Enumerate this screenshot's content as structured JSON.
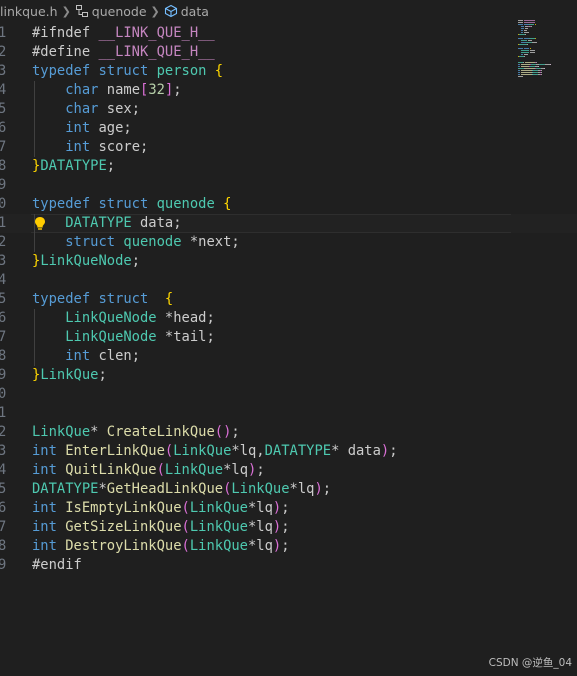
{
  "breadcrumb": {
    "file": "linkque.h",
    "symbol1": "quenode",
    "symbol2": "data",
    "icons": [
      "struct-icon",
      "field-icon"
    ]
  },
  "colors": {
    "background": "#1f1f1f",
    "keyword": "#569cd6",
    "type": "#4ec9b0",
    "function": "#dcdcaa",
    "variable": "#9cdcfe",
    "macro": "#c586c0",
    "number": "#b5cea8",
    "brace": "#ffd700",
    "paren": "#da70d6",
    "default": "#cccccc",
    "lineNumber": "#6e7681"
  },
  "editor": {
    "current_line": 10,
    "lines": [
      {
        "n": "1",
        "tokens": [
          {
            "t": "#ifndef ",
            "c": "default"
          },
          {
            "t": "__LINK_QUE_H__",
            "c": "macro"
          }
        ]
      },
      {
        "n": "2",
        "tokens": [
          {
            "t": "#define ",
            "c": "default"
          },
          {
            "t": "__LINK_QUE_H__",
            "c": "macro"
          }
        ]
      },
      {
        "n": "3",
        "tokens": [
          {
            "t": "typedef ",
            "c": "keyword"
          },
          {
            "t": "struct ",
            "c": "keyword"
          },
          {
            "t": "person ",
            "c": "type"
          },
          {
            "t": "{",
            "c": "brace"
          }
        ]
      },
      {
        "n": "4",
        "tokens": [
          {
            "t": "    ",
            "c": "default"
          },
          {
            "t": "char ",
            "c": "keyword"
          },
          {
            "t": "name",
            "c": "default"
          },
          {
            "t": "[",
            "c": "paren"
          },
          {
            "t": "32",
            "c": "number"
          },
          {
            "t": "]",
            "c": "paren"
          },
          {
            "t": ";",
            "c": "default"
          }
        ]
      },
      {
        "n": "5",
        "tokens": [
          {
            "t": "    ",
            "c": "default"
          },
          {
            "t": "char ",
            "c": "keyword"
          },
          {
            "t": "sex;",
            "c": "default"
          }
        ]
      },
      {
        "n": "6",
        "tokens": [
          {
            "t": "    ",
            "c": "default"
          },
          {
            "t": "int ",
            "c": "keyword"
          },
          {
            "t": "age;",
            "c": "default"
          }
        ]
      },
      {
        "n": "7",
        "tokens": [
          {
            "t": "    ",
            "c": "default"
          },
          {
            "t": "int ",
            "c": "keyword"
          },
          {
            "t": "score;",
            "c": "default"
          }
        ]
      },
      {
        "n": "8",
        "tokens": [
          {
            "t": "}",
            "c": "brace"
          },
          {
            "t": "DATATYPE",
            "c": "type"
          },
          {
            "t": ";",
            "c": "default"
          }
        ]
      },
      {
        "n": "9",
        "tokens": []
      },
      {
        "n": "0",
        "tokens": [
          {
            "t": "typedef ",
            "c": "keyword"
          },
          {
            "t": "struct ",
            "c": "keyword"
          },
          {
            "t": "quenode ",
            "c": "type"
          },
          {
            "t": "{",
            "c": "brace"
          }
        ]
      },
      {
        "n": "1",
        "tokens": [
          {
            "t": "    ",
            "c": "default"
          },
          {
            "t": "DATATYPE ",
            "c": "type"
          },
          {
            "t": "data;",
            "c": "default"
          }
        ]
      },
      {
        "n": "2",
        "tokens": [
          {
            "t": "    ",
            "c": "default"
          },
          {
            "t": "struct ",
            "c": "keyword"
          },
          {
            "t": "quenode ",
            "c": "type"
          },
          {
            "t": "*next;",
            "c": "default"
          }
        ]
      },
      {
        "n": "3",
        "tokens": [
          {
            "t": "}",
            "c": "brace"
          },
          {
            "t": "LinkQueNode",
            "c": "type"
          },
          {
            "t": ";",
            "c": "default"
          }
        ]
      },
      {
        "n": "4",
        "tokens": []
      },
      {
        "n": "5",
        "tokens": [
          {
            "t": "typedef ",
            "c": "keyword"
          },
          {
            "t": "struct  ",
            "c": "keyword"
          },
          {
            "t": "{",
            "c": "brace"
          }
        ]
      },
      {
        "n": "6",
        "tokens": [
          {
            "t": "    ",
            "c": "default"
          },
          {
            "t": "LinkQueNode ",
            "c": "type"
          },
          {
            "t": "*head;",
            "c": "default"
          }
        ]
      },
      {
        "n": "7",
        "tokens": [
          {
            "t": "    ",
            "c": "default"
          },
          {
            "t": "LinkQueNode ",
            "c": "type"
          },
          {
            "t": "*tail;",
            "c": "default"
          }
        ]
      },
      {
        "n": "8",
        "tokens": [
          {
            "t": "    ",
            "c": "default"
          },
          {
            "t": "int ",
            "c": "keyword"
          },
          {
            "t": "clen;",
            "c": "default"
          }
        ]
      },
      {
        "n": "9",
        "tokens": [
          {
            "t": "}",
            "c": "brace"
          },
          {
            "t": "LinkQue",
            "c": "type"
          },
          {
            "t": ";",
            "c": "default"
          }
        ]
      },
      {
        "n": "0",
        "tokens": []
      },
      {
        "n": "1",
        "tokens": []
      },
      {
        "n": "2",
        "tokens": [
          {
            "t": "LinkQue",
            "c": "type"
          },
          {
            "t": "* ",
            "c": "default"
          },
          {
            "t": "CreateLinkQue",
            "c": "function"
          },
          {
            "t": "()",
            "c": "paren"
          },
          {
            "t": ";",
            "c": "default"
          }
        ]
      },
      {
        "n": "3",
        "tokens": [
          {
            "t": "int ",
            "c": "keyword"
          },
          {
            "t": "EnterLinkQue",
            "c": "function"
          },
          {
            "t": "(",
            "c": "paren"
          },
          {
            "t": "LinkQue",
            "c": "type"
          },
          {
            "t": "*lq,",
            "c": "default"
          },
          {
            "t": "DATATYPE",
            "c": "type"
          },
          {
            "t": "* data",
            "c": "default"
          },
          {
            "t": ")",
            "c": "paren"
          },
          {
            "t": ";",
            "c": "default"
          }
        ]
      },
      {
        "n": "4",
        "tokens": [
          {
            "t": "int ",
            "c": "keyword"
          },
          {
            "t": "QuitLinkQue",
            "c": "function"
          },
          {
            "t": "(",
            "c": "paren"
          },
          {
            "t": "LinkQue",
            "c": "type"
          },
          {
            "t": "*lq",
            "c": "default"
          },
          {
            "t": ")",
            "c": "paren"
          },
          {
            "t": ";",
            "c": "default"
          }
        ]
      },
      {
        "n": "5",
        "tokens": [
          {
            "t": "DATATYPE",
            "c": "type"
          },
          {
            "t": "*",
            "c": "default"
          },
          {
            "t": "GetHeadLinkQue",
            "c": "function"
          },
          {
            "t": "(",
            "c": "paren"
          },
          {
            "t": "LinkQue",
            "c": "type"
          },
          {
            "t": "*lq",
            "c": "default"
          },
          {
            "t": ")",
            "c": "paren"
          },
          {
            "t": ";",
            "c": "default"
          }
        ]
      },
      {
        "n": "6",
        "tokens": [
          {
            "t": "int ",
            "c": "keyword"
          },
          {
            "t": "IsEmptyLinkQue",
            "c": "function"
          },
          {
            "t": "(",
            "c": "paren"
          },
          {
            "t": "LinkQue",
            "c": "type"
          },
          {
            "t": "*lq",
            "c": "default"
          },
          {
            "t": ")",
            "c": "paren"
          },
          {
            "t": ";",
            "c": "default"
          }
        ]
      },
      {
        "n": "7",
        "tokens": [
          {
            "t": "int ",
            "c": "keyword"
          },
          {
            "t": "GetSizeLinkQue",
            "c": "function"
          },
          {
            "t": "(",
            "c": "paren"
          },
          {
            "t": "LinkQue",
            "c": "type"
          },
          {
            "t": "*lq",
            "c": "default"
          },
          {
            "t": ")",
            "c": "paren"
          },
          {
            "t": ";",
            "c": "default"
          }
        ]
      },
      {
        "n": "8",
        "tokens": [
          {
            "t": "int ",
            "c": "keyword"
          },
          {
            "t": "DestroyLinkQue",
            "c": "function"
          },
          {
            "t": "(",
            "c": "paren"
          },
          {
            "t": "LinkQue",
            "c": "type"
          },
          {
            "t": "*lq",
            "c": "default"
          },
          {
            "t": ")",
            "c": "paren"
          },
          {
            "t": ";",
            "c": "default"
          }
        ]
      },
      {
        "n": "9",
        "tokens": [
          {
            "t": "#endif",
            "c": "default"
          }
        ]
      }
    ]
  },
  "watermark": "CSDN @逆鱼_04"
}
